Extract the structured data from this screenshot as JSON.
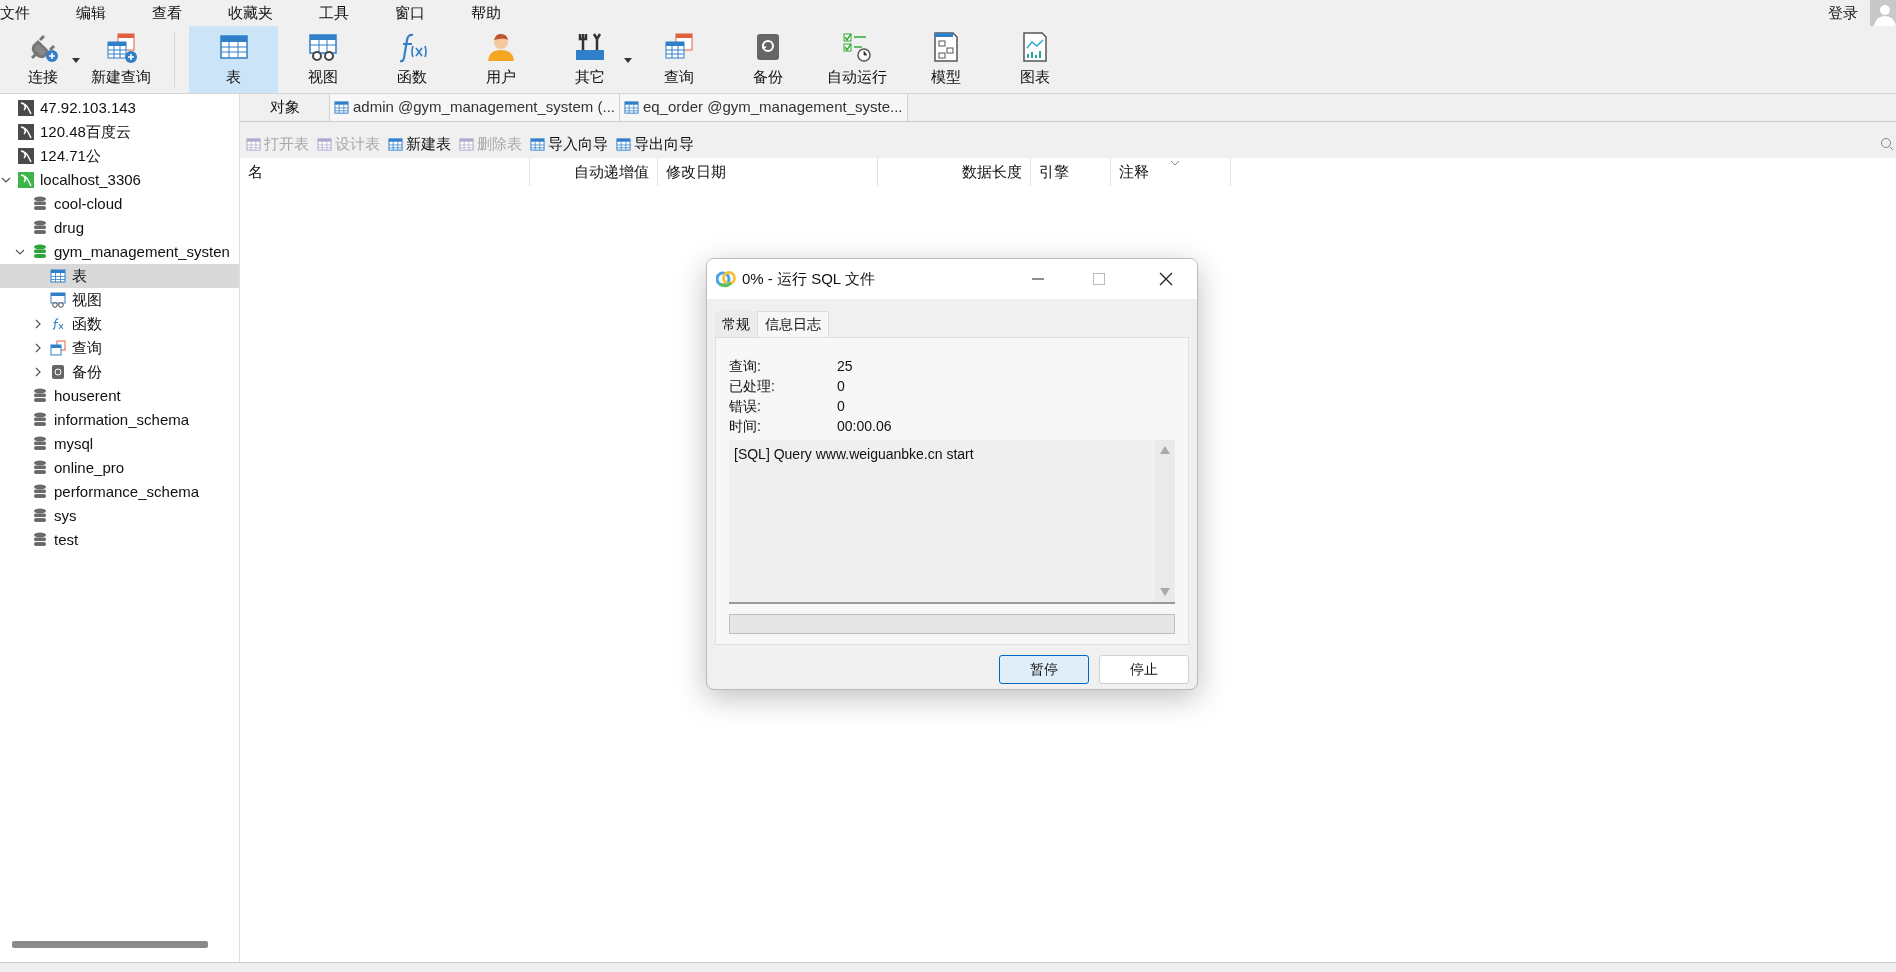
{
  "menu": [
    "文件",
    "编辑",
    "查看",
    "收藏夹",
    "工具",
    "窗口",
    "帮助"
  ],
  "login": "登录",
  "toolbar": [
    {
      "label": "连接",
      "selected": false,
      "dropdown": true
    },
    {
      "label": "新建查询",
      "selected": false,
      "dropdown": false
    },
    {
      "label": "表",
      "selected": true,
      "dropdown": false
    },
    {
      "label": "视图",
      "selected": false,
      "dropdown": false
    },
    {
      "label": "函数",
      "selected": false,
      "dropdown": false
    },
    {
      "label": "用户",
      "selected": false,
      "dropdown": false
    },
    {
      "label": "其它",
      "selected": false,
      "dropdown": true
    },
    {
      "label": "查询",
      "selected": false,
      "dropdown": false
    },
    {
      "label": "备份",
      "selected": false,
      "dropdown": false
    },
    {
      "label": "自动运行",
      "selected": false,
      "dropdown": false
    },
    {
      "label": "模型",
      "selected": false,
      "dropdown": false
    },
    {
      "label": "图表",
      "selected": false,
      "dropdown": false
    }
  ],
  "tree": [
    {
      "kind": "connection",
      "label": "47.92.103.143",
      "active": false,
      "selected": false
    },
    {
      "kind": "connection",
      "label": "120.48百度云",
      "active": false,
      "selected": false
    },
    {
      "kind": "connection",
      "label": "124.71公",
      "active": false,
      "selected": false
    },
    {
      "kind": "connection",
      "label": "localhost_3306",
      "active": true,
      "expanded": true,
      "selected": false,
      "children": [
        {
          "kind": "database",
          "label": "cool-cloud",
          "active": false,
          "selected": false
        },
        {
          "kind": "database",
          "label": "drug",
          "active": false,
          "selected": false
        },
        {
          "kind": "database",
          "label": "gym_management_systen",
          "active": true,
          "expanded": true,
          "selected": false,
          "children": [
            {
              "kind": "table",
              "label": "表",
              "selected": true
            },
            {
              "kind": "view",
              "label": "视图",
              "selected": false
            },
            {
              "kind": "function",
              "label": "函数",
              "expanded": false,
              "selected": false
            },
            {
              "kind": "query",
              "label": "查询",
              "expanded": false,
              "selected": false
            },
            {
              "kind": "backup",
              "label": "备份",
              "expanded": false,
              "selected": false
            }
          ]
        },
        {
          "kind": "database",
          "label": "houserent",
          "active": false,
          "selected": false
        },
        {
          "kind": "database",
          "label": "information_schema",
          "active": false,
          "selected": false
        },
        {
          "kind": "database",
          "label": "mysql",
          "active": false,
          "selected": false
        },
        {
          "kind": "database",
          "label": "online_pro",
          "active": false,
          "selected": false
        },
        {
          "kind": "database",
          "label": "performance_schema",
          "active": false,
          "selected": false
        },
        {
          "kind": "database",
          "label": "sys",
          "active": false,
          "selected": false
        },
        {
          "kind": "database",
          "label": "test",
          "active": false,
          "selected": false
        }
      ]
    }
  ],
  "tabs": [
    {
      "label": "对象",
      "selected": true,
      "kind": "objects"
    },
    {
      "label": "admin @gym_management_system (...",
      "selected": false,
      "kind": "table"
    },
    {
      "label": "eq_order @gym_management_syste...",
      "selected": false,
      "kind": "table"
    }
  ],
  "actions": [
    {
      "label": "打开表",
      "disabled": true
    },
    {
      "label": "设计表",
      "disabled": true
    },
    {
      "label": "新建表",
      "disabled": false
    },
    {
      "label": "删除表",
      "disabled": true
    },
    {
      "label": "导入向导",
      "disabled": false
    },
    {
      "label": "导出向导",
      "disabled": false
    }
  ],
  "columns": [
    "名",
    "自动递增值",
    "修改日期",
    "数据长度",
    "引擎",
    "注释"
  ],
  "dialog": {
    "title": "0% - 运行 SQL 文件",
    "tabs": [
      {
        "label": "常规",
        "selected": false
      },
      {
        "label": "信息日志",
        "selected": true
      }
    ],
    "stats": [
      {
        "label": "查询:",
        "value": "25"
      },
      {
        "label": "已处理:",
        "value": "0"
      },
      {
        "label": "错误:",
        "value": "0"
      },
      {
        "label": "时间:",
        "value": "00:00.06"
      }
    ],
    "log": "[SQL] Query www.weiguanbke.cn start",
    "progress": {
      "level": 0
    },
    "buttons": [
      {
        "label": "暂停",
        "default": true
      },
      {
        "label": "停止",
        "default": false
      }
    ]
  }
}
